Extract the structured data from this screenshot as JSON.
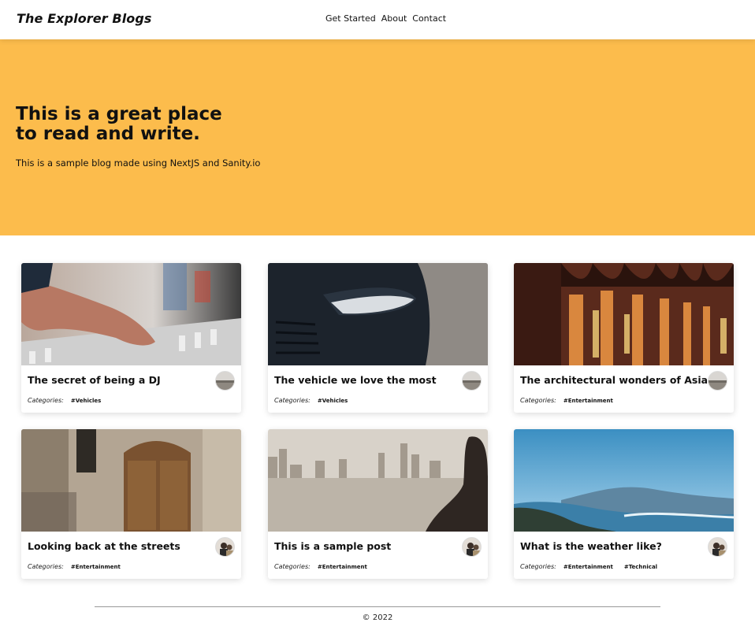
{
  "header": {
    "brand": "The Explorer Blogs",
    "nav": [
      "Get Started",
      "About",
      "Contact"
    ]
  },
  "hero": {
    "title": "This is a great place to read and write.",
    "subtitle": "This is a sample blog made using NextJS and Sanity.io",
    "background": "#fcbc4c"
  },
  "categories_label": "Categories:",
  "posts": [
    {
      "title": "The secret of being a DJ",
      "tags": [
        "#Vehicles"
      ],
      "image": "dj-mixer-image",
      "avatar": "landscape-avatar"
    },
    {
      "title": "The vehicle we love the most",
      "tags": [
        "#Vehicles"
      ],
      "image": "car-headlight-image",
      "avatar": "landscape-avatar"
    },
    {
      "title": "The architectural wonders of Asia",
      "tags": [
        "#Entertainment"
      ],
      "image": "arches-corridor-image",
      "avatar": "landscape-avatar"
    },
    {
      "title": "Looking back at the streets",
      "tags": [
        "#Entertainment"
      ],
      "image": "old-door-image",
      "avatar": "person-avatar"
    },
    {
      "title": "This is a sample post",
      "tags": [
        "#Entertainment"
      ],
      "image": "city-skyline-image",
      "avatar": "person-avatar"
    },
    {
      "title": "What is the weather like?",
      "tags": [
        "#Entertainment",
        "#Technical"
      ],
      "image": "coast-sky-image",
      "avatar": "person-avatar"
    }
  ],
  "footer": {
    "text": "© 2022"
  }
}
